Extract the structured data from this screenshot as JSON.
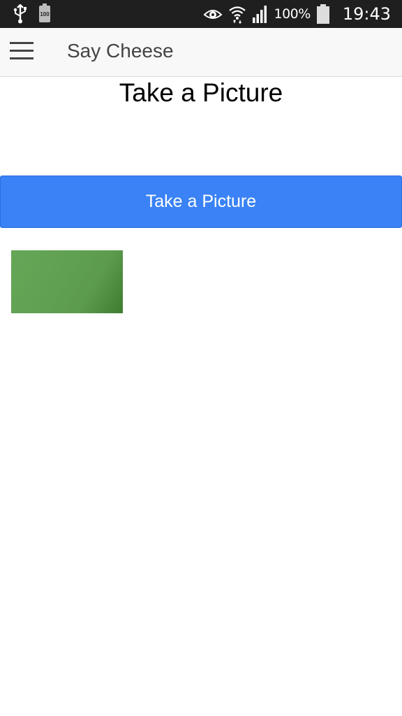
{
  "status_bar": {
    "battery_small_label": "100",
    "battery_percent": "100%",
    "time": "19:43",
    "icons": [
      "usb-icon",
      "battery-small-icon",
      "eye-icon",
      "wifi-icon",
      "signal-icon",
      "battery-icon"
    ]
  },
  "app_bar": {
    "title": "Say Cheese",
    "menu_icon": "hamburger-menu-icon"
  },
  "main": {
    "heading": "Take a Picture",
    "button_label": "Take a Picture"
  },
  "colors": {
    "button": "#3a82f5",
    "status_bar": "#1f1f1f",
    "app_bar": "#f8f8f8",
    "photo": "#60a052"
  }
}
